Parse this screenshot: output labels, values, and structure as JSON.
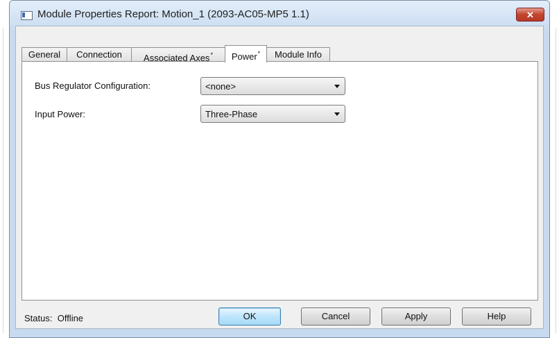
{
  "window": {
    "title": "Module Properties Report: Motion_1 (2093-AC05-MP5 1.1)",
    "close_label": "✕"
  },
  "tabs": [
    {
      "label": "General",
      "modified": false,
      "active": false
    },
    {
      "label": "Connection",
      "modified": false,
      "active": false
    },
    {
      "label": "Associated Axes",
      "modified": true,
      "active": false
    },
    {
      "label": "Power",
      "modified": true,
      "active": true
    },
    {
      "label": "Module Info",
      "modified": false,
      "active": false
    }
  ],
  "power": {
    "bus_regulator": {
      "label": "Bus Regulator Configuration:",
      "value": "<none>"
    },
    "input_power": {
      "label": "Input Power:",
      "value": "Three-Phase"
    }
  },
  "footer": {
    "status_label": "Status:",
    "status_value": "Offline",
    "ok_label": "OK",
    "cancel_label": "Cancel",
    "apply_label": "Apply",
    "help_label": "Help"
  },
  "modified_marker": "*",
  "colors": {
    "title_bar": "#d3e3f4",
    "close_button": "#c7472f",
    "default_button_border": "#3c7fb1"
  }
}
